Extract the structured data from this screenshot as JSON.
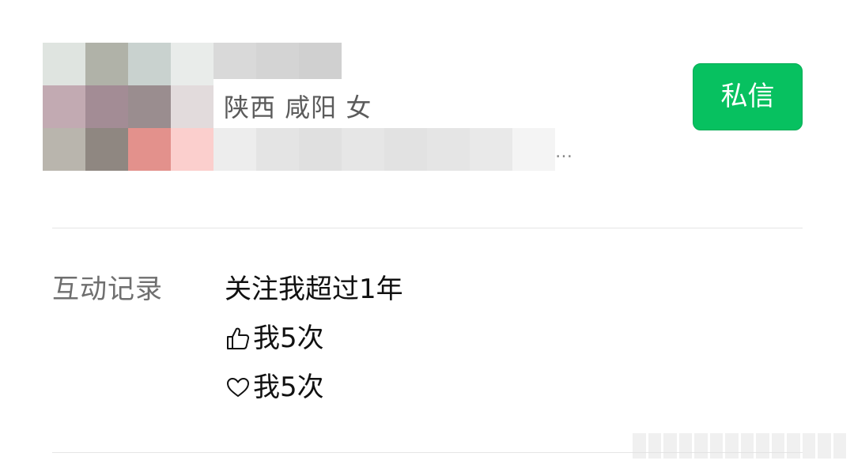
{
  "profile": {
    "location": "陕西 咸阳 女",
    "signature_truncation": "…",
    "avatar_mosaic_colors": [
      "#dfe4e0",
      "#b0b2a8",
      "#c9d2cf",
      "#e9ecea",
      "#c2aab2",
      "#a38c95",
      "#9a8d8f",
      "#e2dbdc",
      "#b9b5ad",
      "#8f8781",
      "#e3918c",
      "#fbcfcd"
    ],
    "name_mosaic_colors": [
      "#d9d9d9",
      "#d4d4d4",
      "#d0d0d0"
    ],
    "signature_mosaic_colors": [
      "#ededed",
      "#e4e4e4",
      "#e0e0e0",
      "#e6e6e6",
      "#e2e2e2",
      "#e5e5e5",
      "#e9e9e9",
      "#f4f4f4"
    ]
  },
  "actions": {
    "message_label": "私信",
    "message_color": "#07c160"
  },
  "interaction": {
    "label": "互动记录",
    "follow_text": "关注我超过1年",
    "like_icon": "thumbs-up-icon",
    "like_text": "我5次",
    "favorite_icon": "heart-icon",
    "favorite_text": "我5次"
  }
}
